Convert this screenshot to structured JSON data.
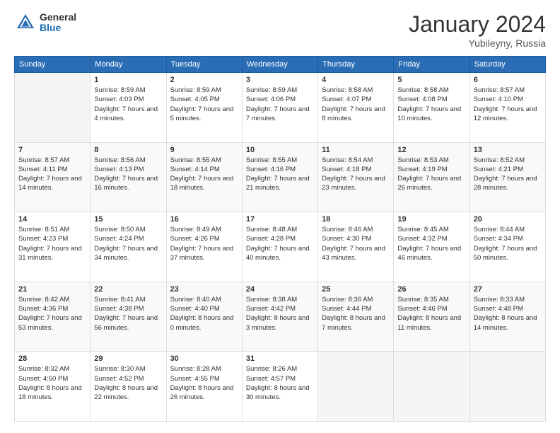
{
  "header": {
    "logo_general": "General",
    "logo_blue": "Blue",
    "month_title": "January 2024",
    "location": "Yubileyny, Russia"
  },
  "days_of_week": [
    "Sunday",
    "Monday",
    "Tuesday",
    "Wednesday",
    "Thursday",
    "Friday",
    "Saturday"
  ],
  "weeks": [
    [
      {
        "day": "",
        "empty": true
      },
      {
        "day": "1",
        "sunrise": "Sunrise: 8:59 AM",
        "sunset": "Sunset: 4:03 PM",
        "daylight": "Daylight: 7 hours and 4 minutes."
      },
      {
        "day": "2",
        "sunrise": "Sunrise: 8:59 AM",
        "sunset": "Sunset: 4:05 PM",
        "daylight": "Daylight: 7 hours and 5 minutes."
      },
      {
        "day": "3",
        "sunrise": "Sunrise: 8:59 AM",
        "sunset": "Sunset: 4:06 PM",
        "daylight": "Daylight: 7 hours and 7 minutes."
      },
      {
        "day": "4",
        "sunrise": "Sunrise: 8:58 AM",
        "sunset": "Sunset: 4:07 PM",
        "daylight": "Daylight: 7 hours and 8 minutes."
      },
      {
        "day": "5",
        "sunrise": "Sunrise: 8:58 AM",
        "sunset": "Sunset: 4:08 PM",
        "daylight": "Daylight: 7 hours and 10 minutes."
      },
      {
        "day": "6",
        "sunrise": "Sunrise: 8:57 AM",
        "sunset": "Sunset: 4:10 PM",
        "daylight": "Daylight: 7 hours and 12 minutes."
      }
    ],
    [
      {
        "day": "7",
        "sunrise": "Sunrise: 8:57 AM",
        "sunset": "Sunset: 4:11 PM",
        "daylight": "Daylight: 7 hours and 14 minutes."
      },
      {
        "day": "8",
        "sunrise": "Sunrise: 8:56 AM",
        "sunset": "Sunset: 4:13 PM",
        "daylight": "Daylight: 7 hours and 16 minutes."
      },
      {
        "day": "9",
        "sunrise": "Sunrise: 8:55 AM",
        "sunset": "Sunset: 4:14 PM",
        "daylight": "Daylight: 7 hours and 18 minutes."
      },
      {
        "day": "10",
        "sunrise": "Sunrise: 8:55 AM",
        "sunset": "Sunset: 4:16 PM",
        "daylight": "Daylight: 7 hours and 21 minutes."
      },
      {
        "day": "11",
        "sunrise": "Sunrise: 8:54 AM",
        "sunset": "Sunset: 4:18 PM",
        "daylight": "Daylight: 7 hours and 23 minutes."
      },
      {
        "day": "12",
        "sunrise": "Sunrise: 8:53 AM",
        "sunset": "Sunset: 4:19 PM",
        "daylight": "Daylight: 7 hours and 26 minutes."
      },
      {
        "day": "13",
        "sunrise": "Sunrise: 8:52 AM",
        "sunset": "Sunset: 4:21 PM",
        "daylight": "Daylight: 7 hours and 28 minutes."
      }
    ],
    [
      {
        "day": "14",
        "sunrise": "Sunrise: 8:51 AM",
        "sunset": "Sunset: 4:23 PM",
        "daylight": "Daylight: 7 hours and 31 minutes."
      },
      {
        "day": "15",
        "sunrise": "Sunrise: 8:50 AM",
        "sunset": "Sunset: 4:24 PM",
        "daylight": "Daylight: 7 hours and 34 minutes."
      },
      {
        "day": "16",
        "sunrise": "Sunrise: 8:49 AM",
        "sunset": "Sunset: 4:26 PM",
        "daylight": "Daylight: 7 hours and 37 minutes."
      },
      {
        "day": "17",
        "sunrise": "Sunrise: 8:48 AM",
        "sunset": "Sunset: 4:28 PM",
        "daylight": "Daylight: 7 hours and 40 minutes."
      },
      {
        "day": "18",
        "sunrise": "Sunrise: 8:46 AM",
        "sunset": "Sunset: 4:30 PM",
        "daylight": "Daylight: 7 hours and 43 minutes."
      },
      {
        "day": "19",
        "sunrise": "Sunrise: 8:45 AM",
        "sunset": "Sunset: 4:32 PM",
        "daylight": "Daylight: 7 hours and 46 minutes."
      },
      {
        "day": "20",
        "sunrise": "Sunrise: 8:44 AM",
        "sunset": "Sunset: 4:34 PM",
        "daylight": "Daylight: 7 hours and 50 minutes."
      }
    ],
    [
      {
        "day": "21",
        "sunrise": "Sunrise: 8:42 AM",
        "sunset": "Sunset: 4:36 PM",
        "daylight": "Daylight: 7 hours and 53 minutes."
      },
      {
        "day": "22",
        "sunrise": "Sunrise: 8:41 AM",
        "sunset": "Sunset: 4:38 PM",
        "daylight": "Daylight: 7 hours and 56 minutes."
      },
      {
        "day": "23",
        "sunrise": "Sunrise: 8:40 AM",
        "sunset": "Sunset: 4:40 PM",
        "daylight": "Daylight: 8 hours and 0 minutes."
      },
      {
        "day": "24",
        "sunrise": "Sunrise: 8:38 AM",
        "sunset": "Sunset: 4:42 PM",
        "daylight": "Daylight: 8 hours and 3 minutes."
      },
      {
        "day": "25",
        "sunrise": "Sunrise: 8:36 AM",
        "sunset": "Sunset: 4:44 PM",
        "daylight": "Daylight: 8 hours and 7 minutes."
      },
      {
        "day": "26",
        "sunrise": "Sunrise: 8:35 AM",
        "sunset": "Sunset: 4:46 PM",
        "daylight": "Daylight: 8 hours and 11 minutes."
      },
      {
        "day": "27",
        "sunrise": "Sunrise: 8:33 AM",
        "sunset": "Sunset: 4:48 PM",
        "daylight": "Daylight: 8 hours and 14 minutes."
      }
    ],
    [
      {
        "day": "28",
        "sunrise": "Sunrise: 8:32 AM",
        "sunset": "Sunset: 4:50 PM",
        "daylight": "Daylight: 8 hours and 18 minutes."
      },
      {
        "day": "29",
        "sunrise": "Sunrise: 8:30 AM",
        "sunset": "Sunset: 4:52 PM",
        "daylight": "Daylight: 8 hours and 22 minutes."
      },
      {
        "day": "30",
        "sunrise": "Sunrise: 8:28 AM",
        "sunset": "Sunset: 4:55 PM",
        "daylight": "Daylight: 8 hours and 26 minutes."
      },
      {
        "day": "31",
        "sunrise": "Sunrise: 8:26 AM",
        "sunset": "Sunset: 4:57 PM",
        "daylight": "Daylight: 8 hours and 30 minutes."
      },
      {
        "day": "",
        "empty": true
      },
      {
        "day": "",
        "empty": true
      },
      {
        "day": "",
        "empty": true
      }
    ]
  ]
}
